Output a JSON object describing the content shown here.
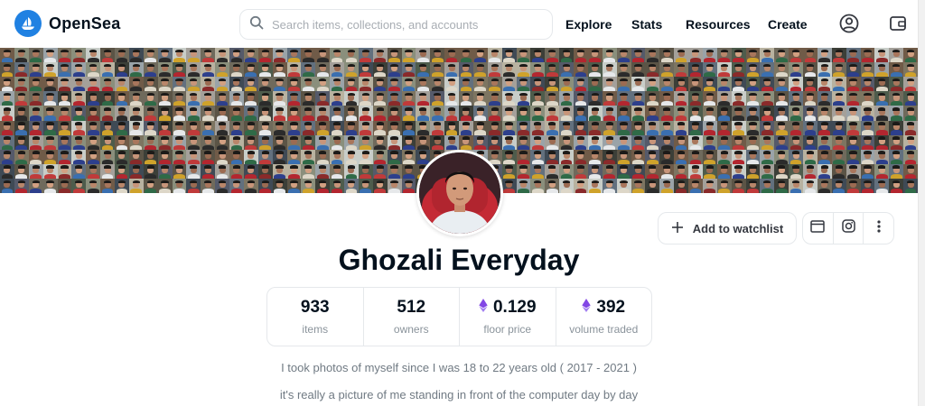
{
  "header": {
    "brand": "OpenSea",
    "search_placeholder": "Search items, collections, and accounts",
    "nav": [
      "Explore",
      "Stats",
      "Resources",
      "Create"
    ]
  },
  "collection": {
    "title": "Ghozali Everyday",
    "description_lines": [
      "I took photos of myself since I was 18 to 22 years old ( 2017 - 2021 )",
      "it's really a picture of me standing in front of the computer day by day"
    ]
  },
  "stats": [
    {
      "value": "933",
      "label": "items",
      "eth": false
    },
    {
      "value": "512",
      "label": "owners",
      "eth": false
    },
    {
      "value": "0.129",
      "label": "floor price",
      "eth": true
    },
    {
      "value": "392",
      "label": "volume traded",
      "eth": true
    }
  ],
  "actions": {
    "watchlist_label": "Add to watchlist"
  },
  "icons": {
    "search": "search-icon",
    "profile": "account-circle-icon",
    "wallet": "wallet-icon",
    "plus": "plus-icon",
    "website": "website-icon",
    "instagram": "instagram-icon",
    "more": "more-vertical-icon",
    "eth": "ethereum-icon"
  },
  "colors": {
    "brand_blue": "#2081e2",
    "text_primary": "#04111d",
    "text_secondary": "#707a83",
    "eth_purple": "#8247e5"
  }
}
